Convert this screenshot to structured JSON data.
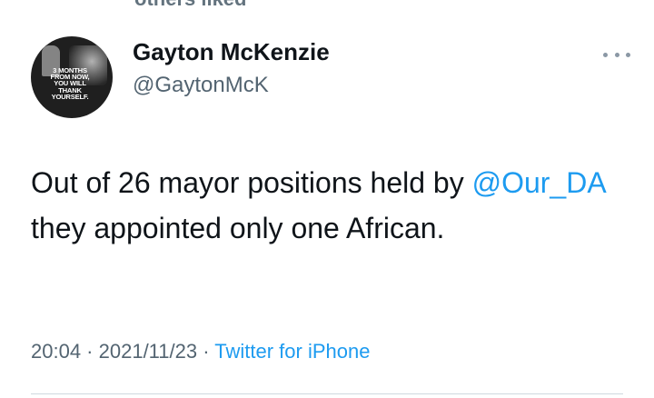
{
  "context_label": "others liked",
  "author": {
    "name": "Gayton McKenzie",
    "handle": "@GaytonMcK",
    "avatar_text": [
      "3 MONTHS",
      "FROM NOW,",
      "YOU WILL",
      "THANK",
      "YOURSELF."
    ]
  },
  "tweet": {
    "text_before": "Out of 26 mayor positions held by ",
    "mention": "@Our_DA",
    "text_after": " they appointed only one African."
  },
  "meta": {
    "time": "20:04",
    "separator": " · ",
    "date": "2021/11/23",
    "source": "Twitter for iPhone"
  },
  "icons": {
    "more": "more-options-icon"
  },
  "colors": {
    "link": "#1d9bf0",
    "secondary_text": "#536471",
    "primary_text": "#0f1419"
  }
}
